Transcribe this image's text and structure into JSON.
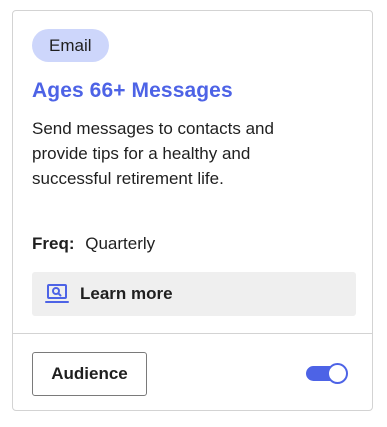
{
  "card": {
    "badge": "Email",
    "title": "Ages 66+ Messages",
    "description": "Send messages to contacts and provide tips for a healthy and successful retirement life.",
    "freq_label": "Freq:",
    "freq_value": "Quarterly",
    "learn_more_label": "Learn more",
    "learn_more_icon": "laptop-search-icon",
    "audience_button_label": "Audience",
    "toggle_on": true
  },
  "colors": {
    "accent": "#4d63e6",
    "badge_bg": "#cdd6fb",
    "learn_bg": "#efefef",
    "border": "#d3d3d3",
    "text": "#1f1f1f"
  }
}
